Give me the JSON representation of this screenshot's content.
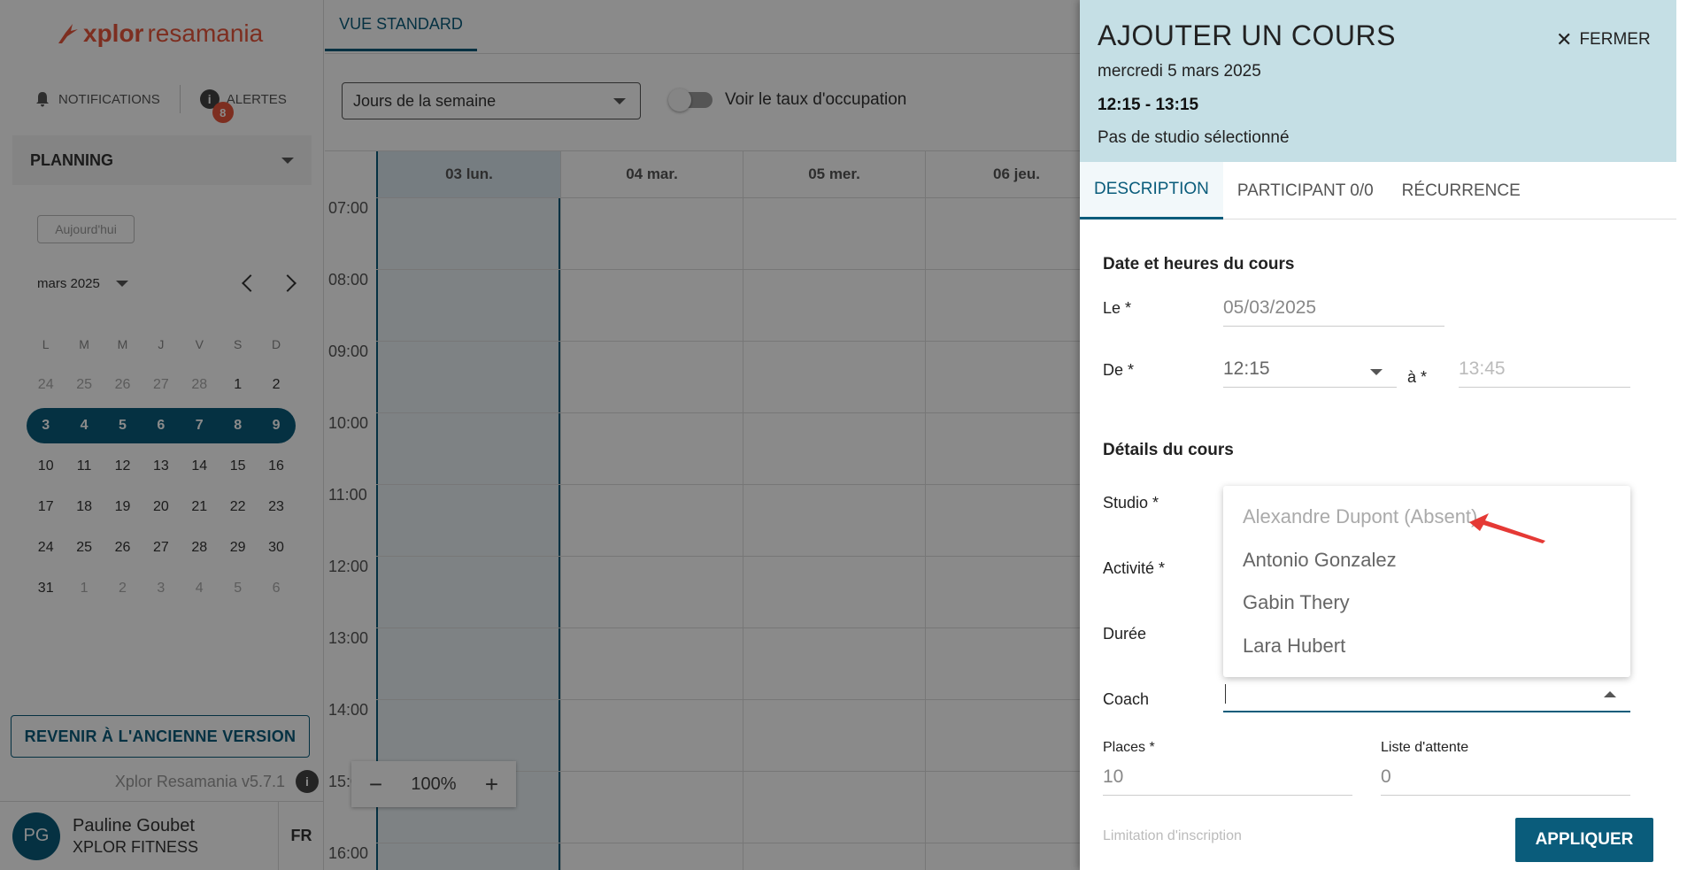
{
  "brand": {
    "name": "xplor",
    "name_rest": " resamania"
  },
  "top_actions": {
    "notifications": "NOTIFICATIONS",
    "alerts": "ALERTES",
    "alerts_count": "8",
    "info_glyph": "i"
  },
  "sidebar": {
    "planning_label": "PLANNING",
    "today_button": "Aujourd'hui",
    "month_label": "mars 2025",
    "weekday_headers": [
      "L",
      "M",
      "M",
      "J",
      "V",
      "S",
      "D"
    ],
    "weeks": [
      [
        "24",
        "25",
        "26",
        "27",
        "28",
        "1",
        "2"
      ],
      [
        "3",
        "4",
        "5",
        "6",
        "7",
        "8",
        "9"
      ],
      [
        "10",
        "11",
        "12",
        "13",
        "14",
        "15",
        "16"
      ],
      [
        "17",
        "18",
        "19",
        "20",
        "21",
        "22",
        "23"
      ],
      [
        "24",
        "25",
        "26",
        "27",
        "28",
        "29",
        "30"
      ],
      [
        "31",
        "1",
        "2",
        "3",
        "4",
        "5",
        "6"
      ]
    ],
    "revert_button": "REVENIR À L'ANCIENNE VERSION",
    "version": "Xplor Resamania v5.7.1",
    "user": {
      "initials": "PG",
      "name": "Pauline Goubet",
      "org": "XPLOR FITNESS",
      "lang": "FR"
    }
  },
  "main": {
    "view_tab": "VUE STANDARD",
    "days_select": "Jours de la semaine",
    "occupancy_toggle": "Voir le taux d'occupation",
    "day_headers": [
      "03 lun.",
      "04 mar.",
      "05 mer.",
      "06 jeu."
    ],
    "hours": [
      "07:00",
      "08:00",
      "09:00",
      "10:00",
      "11:00",
      "12:00",
      "13:00",
      "14:00",
      "15:00",
      "16:00"
    ],
    "zoom": {
      "minus": "−",
      "value": "100%",
      "plus": "+"
    }
  },
  "drawer": {
    "title": "AJOUTER UN COURS",
    "close_label": "FERMER",
    "date": "mercredi 5 mars 2025",
    "time": "12:15 - 13:15",
    "studio_note": "Pas de studio sélectionné",
    "tabs": [
      "DESCRIPTION",
      "PARTICIPANT 0/0",
      "RÉCURRENCE"
    ],
    "form": {
      "section_dates": "Date et heures du cours",
      "le_label": "Le *",
      "le_value": "05/03/2025",
      "de_label": "De *",
      "de_value": "12:15",
      "a_label": "à *",
      "a_value": "13:45",
      "section_details": "Détails du cours",
      "studio_label": "Studio *",
      "activite_label": "Activité *",
      "duree_label": "Durée",
      "coach_label": "Coach",
      "places_label": "Places *",
      "places_value": "10",
      "waitlist_label": "Liste d'attente",
      "waitlist_value": "0",
      "limitation_label": "Limitation d'inscription"
    },
    "coach_options": [
      {
        "label": "Alexandre Dupont (Absent)",
        "disabled": true
      },
      {
        "label": "Antonio Gonzalez",
        "disabled": false
      },
      {
        "label": "Gabin Thery",
        "disabled": false
      },
      {
        "label": "Lara Hubert",
        "disabled": false
      }
    ],
    "apply_button": "APPLIQUER"
  },
  "colors": {
    "brand_teal": "#0a5c7b",
    "brand_orange": "#e8553b",
    "drawer_header": "#c5dfe5",
    "annotation_arrow": "#e53935"
  }
}
